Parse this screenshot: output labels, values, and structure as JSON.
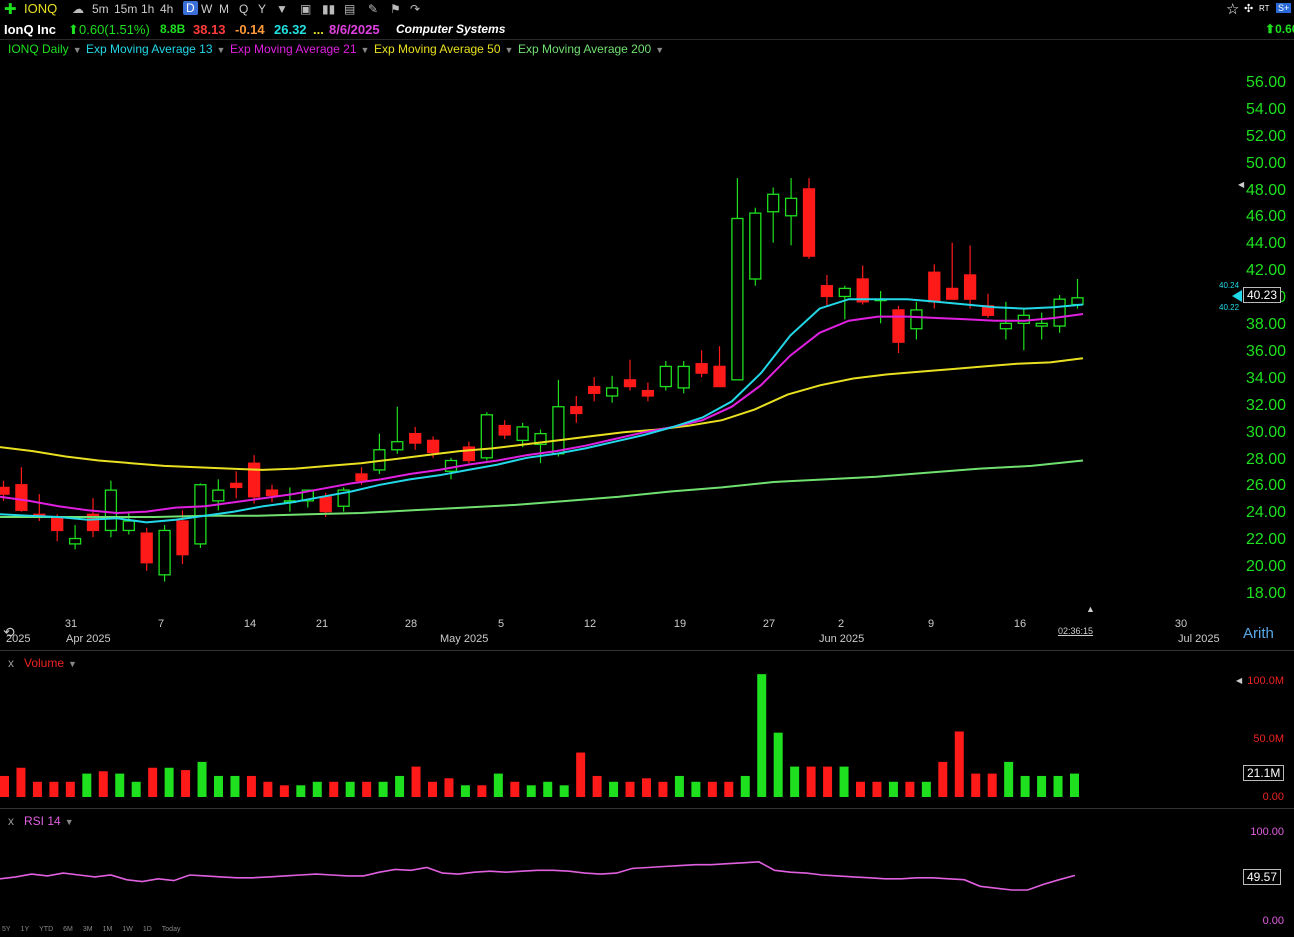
{
  "toolbar": {
    "symbol": "IONQ",
    "timeframes": [
      "5m",
      "15m",
      "1h",
      "4h",
      "D",
      "W",
      "M",
      "Q",
      "Y"
    ],
    "active_timeframe": "D",
    "right_badges": [
      "RT",
      "S+"
    ],
    "right_price": "0.60"
  },
  "info": {
    "company": "IonQ Inc",
    "change": "0.60(1.51%)",
    "market_cap": "8.8B",
    "value1": "38.13",
    "value2": "-0.14",
    "value3": "26.32",
    "ellipsis": "...",
    "earnings_date": "8/6/2025",
    "sector": "Computer Systems",
    "colors": {
      "up": "#1ee01e",
      "down": "#ff3b3b",
      "orange": "#ff9a3a",
      "cyan": "#22e0e0",
      "magenta": "#e040e0",
      "yellow": "#e8e020"
    }
  },
  "legend": [
    {
      "label": "IONQ Daily",
      "color": "#1ee01e"
    },
    {
      "label": "Exp Moving Average 13",
      "color": "#22d8e8"
    },
    {
      "label": "Exp Moving Average 21",
      "color": "#e020e0"
    },
    {
      "label": "Exp Moving Average 50",
      "color": "#e8e020"
    },
    {
      "label": "Exp Moving Average 200",
      "color": "#70e070"
    }
  ],
  "price_axis": {
    "ticks": [
      "56.00",
      "54.00",
      "52.00",
      "50.00",
      "48.00",
      "46.00",
      "44.00",
      "42.00",
      "40.00",
      "38.00",
      "36.00",
      "34.00",
      "32.00",
      "30.00",
      "28.00",
      "26.00",
      "24.00",
      "22.00",
      "20.00",
      "18.00"
    ],
    "last_price": "40.23",
    "ema13_label": "40.24",
    "ema21_label": "40.22",
    "scale": "Arith"
  },
  "x_axis": {
    "day_ticks": [
      "31",
      "7",
      "14",
      "21",
      "28",
      "5",
      "12",
      "19",
      "27",
      "2",
      "9",
      "16",
      "30"
    ],
    "months": [
      "Apr 2025",
      "May 2025",
      "Jun 2025",
      "Jul 2025"
    ],
    "left_label": "2025",
    "timer": "02:36:15"
  },
  "volume_pane": {
    "label": "Volume",
    "ticks": [
      "100.0M",
      "50.0M",
      "0.00"
    ],
    "last": "21.1M"
  },
  "rsi_pane": {
    "label": "RSI 14",
    "ticks": [
      "100.00",
      "0.00"
    ],
    "last": "49.57"
  },
  "bottom_periods": [
    "5Y",
    "1Y",
    "YTD",
    "6M",
    "3M",
    "1M",
    "1W",
    "1D",
    "Today"
  ],
  "chart_data": {
    "type": "candlestick",
    "xlabel": "",
    "ylabel": "",
    "ylim": [
      17,
      57
    ],
    "candles": [
      {
        "o": 26.0,
        "h": 26.5,
        "l": 25.0,
        "c": 25.5
      },
      {
        "o": 26.2,
        "h": 27.5,
        "l": 24.2,
        "c": 24.3
      },
      {
        "o": 24.0,
        "h": 25.5,
        "l": 23.5,
        "c": 23.8
      },
      {
        "o": 23.8,
        "h": 24.0,
        "l": 22.0,
        "c": 22.8
      },
      {
        "o": 21.8,
        "h": 23.2,
        "l": 21.4,
        "c": 22.2
      },
      {
        "o": 24.0,
        "h": 25.2,
        "l": 22.3,
        "c": 22.8
      },
      {
        "o": 22.8,
        "h": 26.5,
        "l": 22.3,
        "c": 25.8
      },
      {
        "o": 22.8,
        "h": 24.2,
        "l": 22.5,
        "c": 23.5
      },
      {
        "o": 22.6,
        "h": 23.0,
        "l": 19.8,
        "c": 20.4
      },
      {
        "o": 19.5,
        "h": 23.2,
        "l": 19.0,
        "c": 22.8
      },
      {
        "o": 23.5,
        "h": 24.3,
        "l": 20.3,
        "c": 21.0
      },
      {
        "o": 21.8,
        "h": 26.3,
        "l": 21.5,
        "c": 26.2
      },
      {
        "o": 25.0,
        "h": 26.6,
        "l": 24.3,
        "c": 25.8
      },
      {
        "o": 26.3,
        "h": 27.2,
        "l": 25.2,
        "c": 26.0
      },
      {
        "o": 27.8,
        "h": 28.4,
        "l": 24.8,
        "c": 25.3
      },
      {
        "o": 25.8,
        "h": 26.2,
        "l": 24.9,
        "c": 25.4
      },
      {
        "o": 25.0,
        "h": 26.0,
        "l": 24.2,
        "c": 25.0
      },
      {
        "o": 25.0,
        "h": 25.8,
        "l": 24.5,
        "c": 25.8
      },
      {
        "o": 25.3,
        "h": 25.6,
        "l": 23.8,
        "c": 24.2
      },
      {
        "o": 24.6,
        "h": 26.0,
        "l": 24.2,
        "c": 25.8
      },
      {
        "o": 27.0,
        "h": 27.5,
        "l": 26.2,
        "c": 26.5
      },
      {
        "o": 27.3,
        "h": 30.0,
        "l": 27.0,
        "c": 28.8
      },
      {
        "o": 28.8,
        "h": 32.0,
        "l": 28.5,
        "c": 29.4
      },
      {
        "o": 30.0,
        "h": 30.5,
        "l": 28.8,
        "c": 29.3
      },
      {
        "o": 29.5,
        "h": 29.8,
        "l": 28.2,
        "c": 28.6
      },
      {
        "o": 27.2,
        "h": 28.2,
        "l": 26.6,
        "c": 28.0
      },
      {
        "o": 29.0,
        "h": 29.4,
        "l": 27.8,
        "c": 28.0
      },
      {
        "o": 28.2,
        "h": 31.6,
        "l": 28.0,
        "c": 31.4
      },
      {
        "o": 30.6,
        "h": 31.0,
        "l": 29.6,
        "c": 29.9
      },
      {
        "o": 29.5,
        "h": 30.8,
        "l": 29.0,
        "c": 30.5
      },
      {
        "o": 29.2,
        "h": 30.3,
        "l": 27.8,
        "c": 30.0
      },
      {
        "o": 28.5,
        "h": 34.0,
        "l": 28.3,
        "c": 32.0
      },
      {
        "o": 32.0,
        "h": 32.8,
        "l": 30.8,
        "c": 31.5
      },
      {
        "o": 33.5,
        "h": 34.2,
        "l": 32.4,
        "c": 33.0
      },
      {
        "o": 32.8,
        "h": 34.3,
        "l": 32.3,
        "c": 33.4
      },
      {
        "o": 34.0,
        "h": 35.5,
        "l": 33.2,
        "c": 33.5
      },
      {
        "o": 33.2,
        "h": 33.8,
        "l": 32.4,
        "c": 32.8
      },
      {
        "o": 33.5,
        "h": 35.4,
        "l": 33.2,
        "c": 35.0
      },
      {
        "o": 33.4,
        "h": 35.4,
        "l": 33.0,
        "c": 35.0
      },
      {
        "o": 35.2,
        "h": 36.2,
        "l": 34.2,
        "c": 34.5
      },
      {
        "o": 35.0,
        "h": 36.5,
        "l": 33.5,
        "c": 33.5
      },
      {
        "o": 34.0,
        "h": 49.0,
        "l": 34.0,
        "c": 46.0
      },
      {
        "o": 41.5,
        "h": 46.8,
        "l": 41.0,
        "c": 46.4
      },
      {
        "o": 46.5,
        "h": 48.3,
        "l": 44.2,
        "c": 47.8
      },
      {
        "o": 46.2,
        "h": 49.0,
        "l": 44.0,
        "c": 47.5
      },
      {
        "o": 48.2,
        "h": 49.0,
        "l": 43.0,
        "c": 43.2
      },
      {
        "o": 41.0,
        "h": 41.8,
        "l": 39.5,
        "c": 40.2
      },
      {
        "o": 40.2,
        "h": 41.0,
        "l": 38.5,
        "c": 40.8
      },
      {
        "o": 41.5,
        "h": 42.5,
        "l": 39.6,
        "c": 39.8
      },
      {
        "o": 40.0,
        "h": 40.6,
        "l": 38.2,
        "c": 40.0
      },
      {
        "o": 39.2,
        "h": 39.5,
        "l": 36.0,
        "c": 36.8
      },
      {
        "o": 37.8,
        "h": 39.8,
        "l": 37.0,
        "c": 39.2
      },
      {
        "o": 42.0,
        "h": 42.6,
        "l": 39.3,
        "c": 39.8
      },
      {
        "o": 40.8,
        "h": 44.2,
        "l": 40.0,
        "c": 40.0
      },
      {
        "o": 41.8,
        "h": 44.0,
        "l": 39.3,
        "c": 40.0
      },
      {
        "o": 39.5,
        "h": 40.4,
        "l": 38.6,
        "c": 38.8
      },
      {
        "o": 37.8,
        "h": 39.8,
        "l": 37.0,
        "c": 38.2
      },
      {
        "o": 38.2,
        "h": 39.3,
        "l": 36.2,
        "c": 38.8
      },
      {
        "o": 38.0,
        "h": 39.0,
        "l": 37.0,
        "c": 38.2
      },
      {
        "o": 38.0,
        "h": 40.3,
        "l": 37.5,
        "c": 40.0
      },
      {
        "o": 39.6,
        "h": 41.5,
        "l": 39.3,
        "c": 40.1
      }
    ],
    "ema13": [
      24.0,
      23.9,
      23.8,
      23.6,
      23.7,
      23.4,
      23.6,
      23.9,
      24.2,
      24.6,
      24.9,
      25.3,
      25.7,
      26.2,
      26.6,
      26.9,
      27.3,
      27.7,
      28.2,
      28.5,
      28.9,
      29.4,
      29.9,
      30.5,
      31.2,
      32.4,
      34.5,
      37.3,
      39.3,
      40.0,
      40.0,
      40.0,
      39.8,
      39.6,
      39.4,
      39.3,
      39.4,
      39.6
    ],
    "ema21": [
      25.3,
      25.0,
      24.6,
      24.3,
      24.1,
      24.2,
      24.5,
      24.6,
      24.9,
      25.2,
      25.5,
      25.9,
      26.3,
      26.6,
      27.0,
      27.3,
      27.7,
      28.0,
      28.4,
      28.7,
      29.1,
      29.6,
      30.1,
      30.5,
      31.0,
      32.0,
      33.6,
      35.8,
      37.5,
      38.4,
      38.7,
      38.7,
      38.6,
      38.5,
      38.4,
      38.4,
      38.6,
      38.9
    ],
    "ema50": [
      29.0,
      28.7,
      28.3,
      28.0,
      27.8,
      27.6,
      27.5,
      27.4,
      27.3,
      27.4,
      27.6,
      27.8,
      28.1,
      28.4,
      28.7,
      28.9,
      29.2,
      29.5,
      29.8,
      30.1,
      30.3,
      30.6,
      31.0,
      31.8,
      32.9,
      33.6,
      34.1,
      34.4,
      34.6,
      34.8,
      35.0,
      35.2,
      35.3,
      35.6
    ],
    "ema200": [
      23.8,
      23.8,
      23.8,
      23.8,
      23.9,
      23.9,
      24.0,
      24.1,
      24.3,
      24.5,
      24.7,
      25.0,
      25.3,
      25.7,
      26.0,
      26.4,
      26.6,
      26.8,
      27.1,
      27.4,
      27.6,
      28.0
    ],
    "volume_m": [
      18,
      25,
      13,
      13,
      13,
      20,
      22,
      20,
      13,
      25,
      25,
      23,
      30,
      18,
      18,
      18,
      13,
      10,
      10,
      13,
      13,
      13,
      13,
      13,
      18,
      26,
      13,
      16,
      10,
      10,
      20,
      13,
      10,
      13,
      10,
      38,
      18,
      13,
      13,
      16,
      13,
      18,
      13,
      13,
      13,
      18,
      105,
      55,
      26,
      26,
      26,
      26,
      13,
      13,
      13,
      13,
      13,
      30,
      56,
      20,
      20,
      30,
      18,
      18,
      18,
      20
    ],
    "rsi": [
      46,
      48,
      51,
      49,
      52,
      50,
      48,
      50,
      45,
      43,
      46,
      44,
      50,
      49,
      48,
      47,
      47,
      48,
      49,
      50,
      51,
      50,
      49,
      49,
      53,
      56,
      55,
      58,
      52,
      51,
      53,
      54,
      53,
      54,
      55,
      55,
      54,
      52,
      51,
      52,
      57,
      58,
      59,
      60,
      61,
      61,
      62,
      63,
      64,
      55,
      53,
      52,
      50,
      49,
      48,
      47,
      46,
      46,
      47,
      47,
      46,
      45,
      38,
      36,
      34,
      34,
      40,
      45,
      49.6
    ]
  }
}
